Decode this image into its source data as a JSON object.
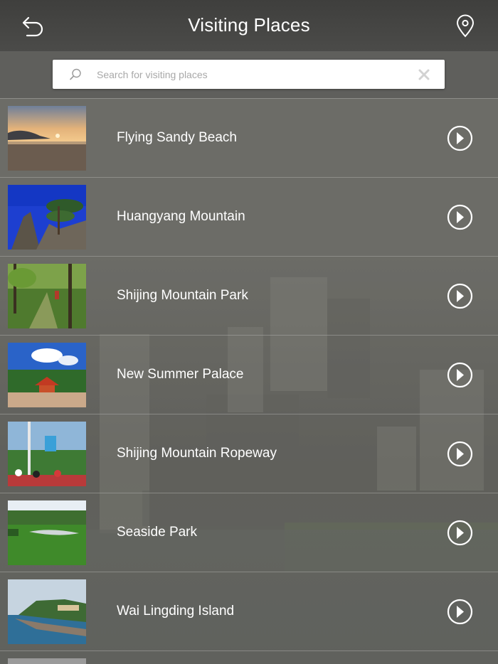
{
  "header": {
    "title": "Visiting Places",
    "back_icon": "back-arrow-icon",
    "location_icon": "map-pin-icon"
  },
  "search": {
    "placeholder": "Search for visiting places",
    "value": "",
    "search_icon": "search-icon",
    "clear_icon": "clear-icon"
  },
  "places": [
    {
      "name": "Flying Sandy Beach",
      "thumb": "beach-sunset"
    },
    {
      "name": "Huangyang Mountain",
      "thumb": "mountain-pine"
    },
    {
      "name": "Shijing Mountain Park",
      "thumb": "forest-park"
    },
    {
      "name": "New Summer Palace",
      "thumb": "palace"
    },
    {
      "name": "Shijing Mountain Ropeway",
      "thumb": "ropeway"
    },
    {
      "name": "Seaside Park",
      "thumb": "lawn-park"
    },
    {
      "name": "Wai Lingding Island",
      "thumb": "island-coast"
    }
  ],
  "row_action_icon": "chevron-right-circle-icon",
  "colors": {
    "header_bg": "#444442",
    "accent_text": "#ffffff"
  }
}
